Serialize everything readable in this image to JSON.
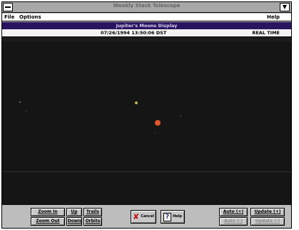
{
  "window": {
    "title": "Weekly Stack Telescope",
    "size_button": "▼"
  },
  "menu": {
    "file": "File",
    "options": "Options",
    "help": "Help"
  },
  "display": {
    "title": "Jupiter's Moons Display",
    "datetime": "07/26/1994 13:50:06 DST",
    "mode": "REAL TIME"
  },
  "colors": {
    "space": "#151515",
    "jupiter": "#e0552a",
    "moon_bright": "#c8b050",
    "moon_dim": "#5a6a5a",
    "title_bar": "#2a1460"
  },
  "controls": {
    "zoom_in": "Zoom In",
    "zoom_out": "Zoom Out",
    "up": "Up",
    "down": "Down",
    "trails": "Trails",
    "orbits": "Orbits",
    "cancel": "Cancel",
    "help": "Help",
    "auto_plus": "Auto (+)",
    "auto_minus": "Auto (-)",
    "update_plus": "Update (+)",
    "update_minus": "Update (-)"
  }
}
